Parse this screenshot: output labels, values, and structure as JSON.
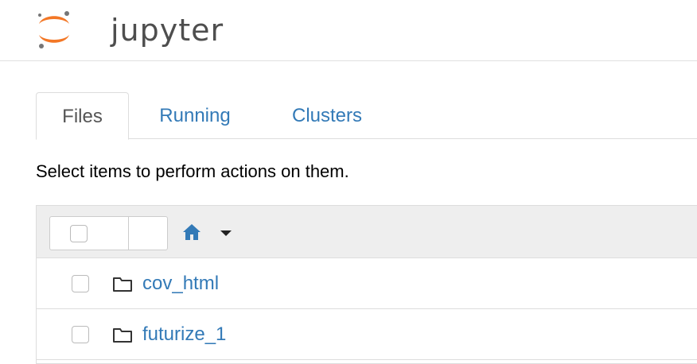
{
  "header": {
    "logo_text": "jupyter",
    "colors": {
      "logo_orange": "#f37726",
      "logo_gray": "#767677"
    }
  },
  "tabs": [
    {
      "label": "Files",
      "active": true
    },
    {
      "label": "Running",
      "active": false
    },
    {
      "label": "Clusters",
      "active": false
    }
  ],
  "instruction": "Select items to perform actions on them.",
  "toolbar": {
    "select_all_icon": "checkbox-icon",
    "dropdown_icon": "caret-down-icon",
    "breadcrumb_icon": "home-icon"
  },
  "items": [
    {
      "name": "cov_html",
      "type_icon": "folder-icon"
    },
    {
      "name": "futurize_1",
      "type_icon": "folder-icon"
    }
  ],
  "colors": {
    "link": "#337ab7",
    "header_bg": "#eeeeee",
    "border": "#dddddd"
  }
}
